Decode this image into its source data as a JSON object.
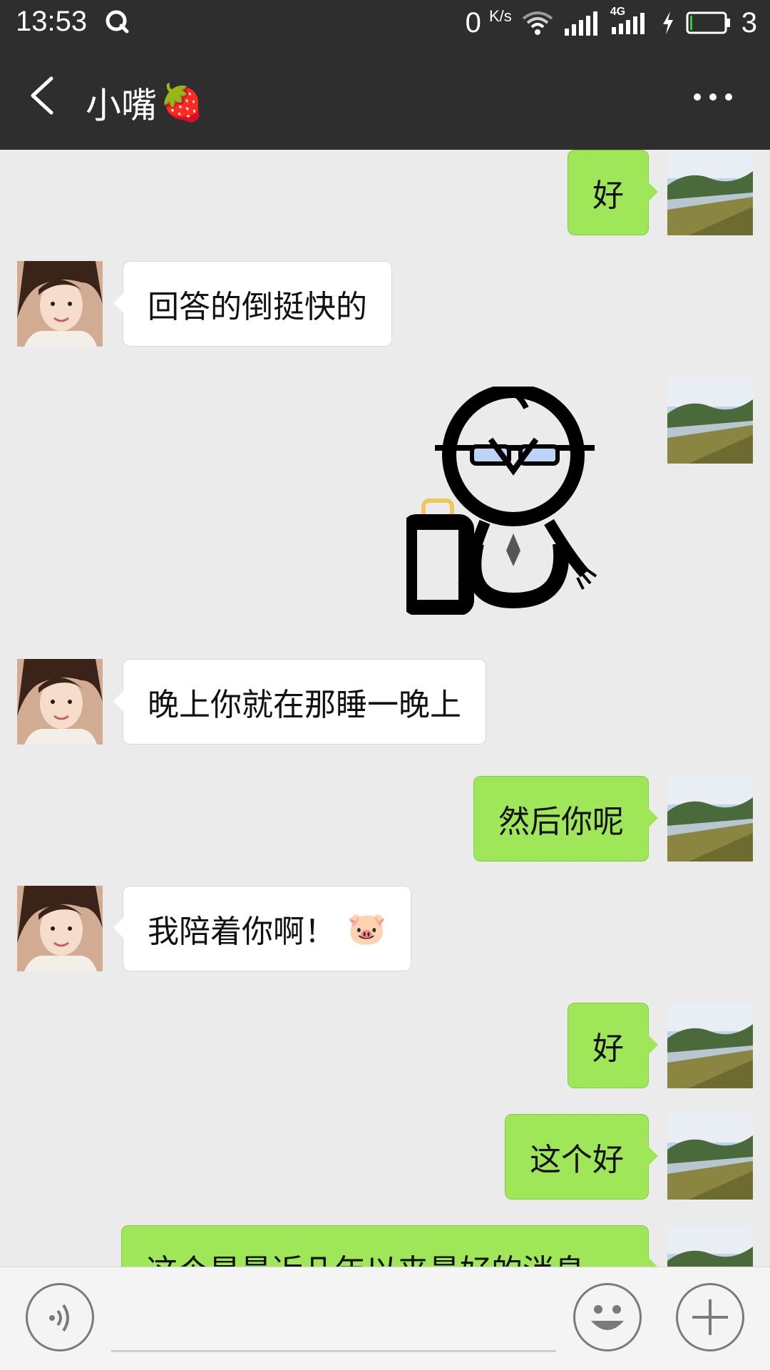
{
  "status_bar": {
    "time": "13:53",
    "net_speed": "0",
    "net_unit": "K/s",
    "network_type": "4G",
    "battery_level": "3",
    "icons": [
      "q-icon",
      "wifi-icon",
      "signal-icon",
      "signal-4g-icon",
      "charging-icon",
      "battery-icon"
    ]
  },
  "header": {
    "title": "小嘴",
    "title_emoji": "🍓"
  },
  "messages": [
    {
      "side": "out",
      "text": "好"
    },
    {
      "side": "in",
      "text": "回答的倒挺快的"
    },
    {
      "side": "out",
      "type": "sticker",
      "sticker_name": "嗯-sticker"
    },
    {
      "side": "in",
      "text": "晚上你就在那睡一晚上"
    },
    {
      "side": "out",
      "text": "然后你呢"
    },
    {
      "side": "in",
      "text": "我陪着你啊！",
      "emoji": "🐷"
    },
    {
      "side": "out",
      "text": "好"
    },
    {
      "side": "out",
      "text": "这个好"
    },
    {
      "side": "out",
      "text": "这个是最近几年以来最好的消息"
    }
  ],
  "input_bar": {
    "icons": [
      "voice-icon",
      "emoji-icon",
      "plus-icon"
    ]
  },
  "colors": {
    "bar_bg": "#2e2e2e",
    "chat_bg": "#ebebeb",
    "out_bubble": "#9fe658",
    "in_bubble": "#ffffff"
  }
}
